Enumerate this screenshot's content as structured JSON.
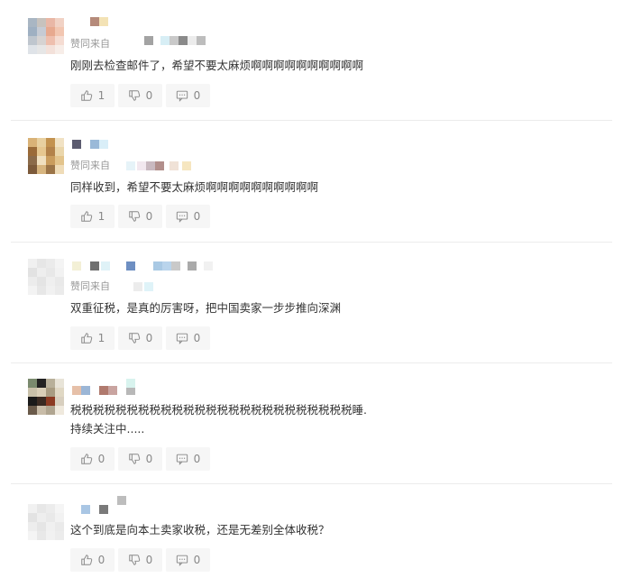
{
  "agree_label": "赞同来自",
  "comments": [
    {
      "text_lines": [
        "刚刚去检查邮件了，希望不要太麻烦啊啊啊啊啊啊啊啊啊啊"
      ],
      "likes": "1",
      "dislikes": "0",
      "replies": "0"
    },
    {
      "text_lines": [
        "同样收到，希望不要太麻烦啊啊啊啊啊啊啊啊啊啊"
      ],
      "likes": "1",
      "dislikes": "0",
      "replies": "0"
    },
    {
      "text_lines": [
        "双重征税，是真的厉害呀，把中国卖家一步步推向深渊"
      ],
      "likes": "1",
      "dislikes": "0",
      "replies": "0"
    },
    {
      "text_lines": [
        "税税税税税税税税税税税税税税税税税税税税税税税税税睡.",
        "持续关注中....."
      ],
      "likes": "0",
      "dislikes": "0",
      "replies": "0"
    },
    {
      "text_lines": [
        "这个到底是向本土卖家收税，还是无差别全体收税？"
      ],
      "likes": "0",
      "dislikes": "0",
      "replies": "0"
    }
  ],
  "colors": {
    "text": "#333333",
    "muted": "#999999",
    "action_bg": "#f6f6f6",
    "divider": "#ececec"
  },
  "icons": [
    "thumbs-up-icon",
    "thumbs-down-icon",
    "comment-bubble-icon"
  ]
}
